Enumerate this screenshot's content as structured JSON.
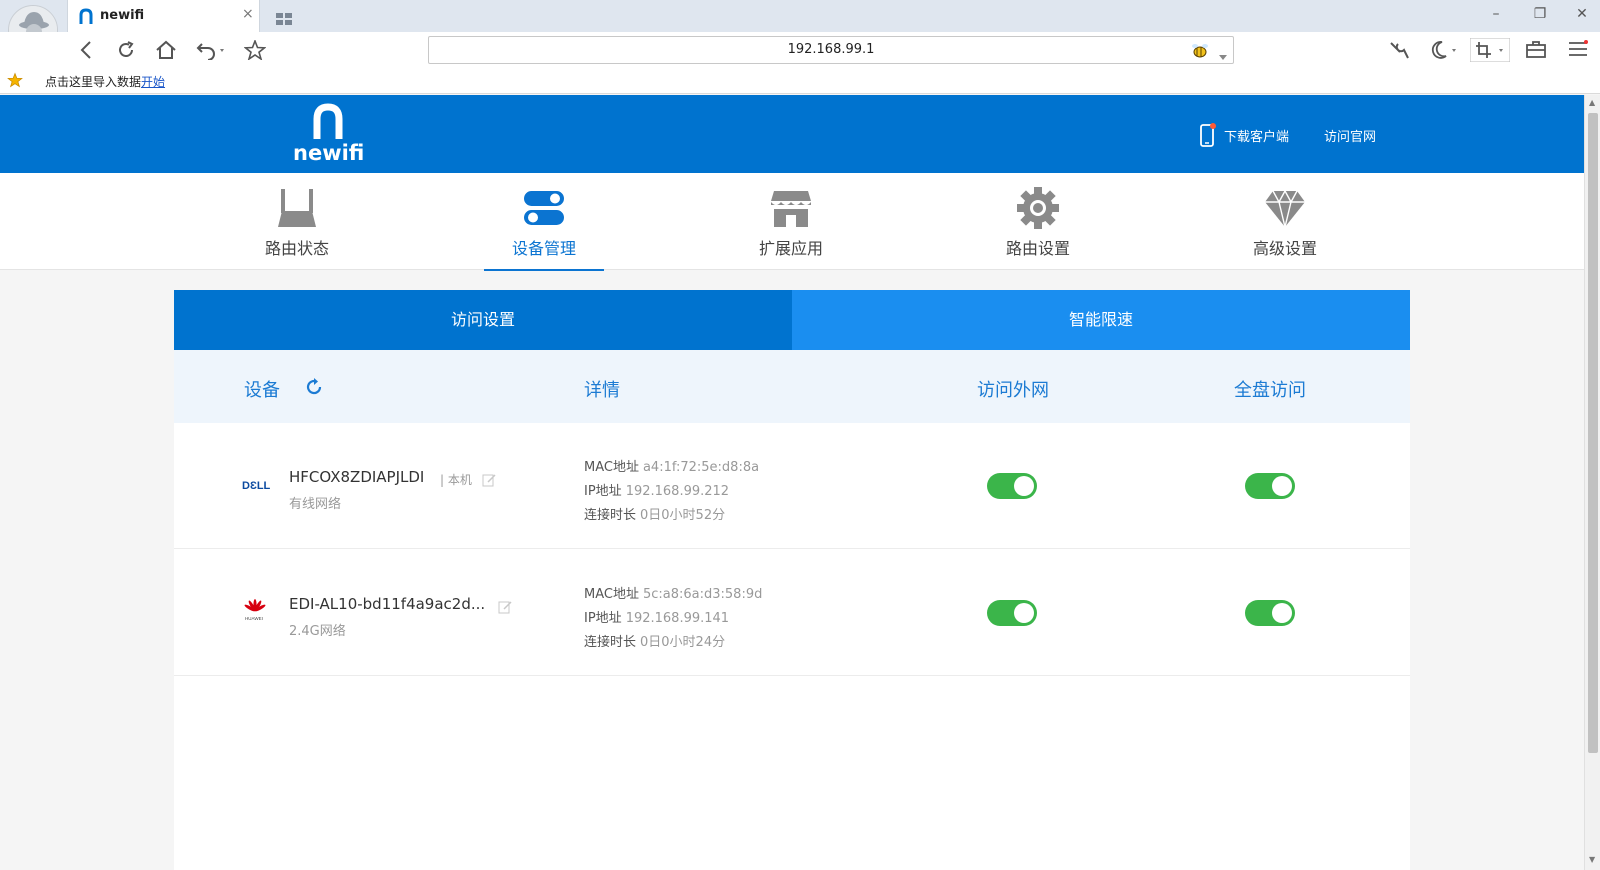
{
  "browser": {
    "tab_title": "newifi",
    "url": "192.168.99.1",
    "bookmark_prompt": "点击这里导入数据",
    "bookmark_link": "开始"
  },
  "header": {
    "logo_text": "newifi",
    "download_client": "下载客户端",
    "visit_site": "访问官网"
  },
  "nav": {
    "items": [
      {
        "label": "路由状态"
      },
      {
        "label": "设备管理"
      },
      {
        "label": "扩展应用"
      },
      {
        "label": "路由设置"
      },
      {
        "label": "高级设置"
      }
    ]
  },
  "subtabs": {
    "access": "访问设置",
    "speed": "智能限速"
  },
  "columns": {
    "device": "设备",
    "details": "详情",
    "internet": "访问外网",
    "disk": "全盘访问"
  },
  "labels": {
    "mac": "MAC地址",
    "ip": "IP地址",
    "duration": "连接时长"
  },
  "devices": [
    {
      "brand": "DELL",
      "name": "HFCOX8ZDIAPJLDI",
      "tag": "本机",
      "network": "有线网络",
      "mac": "a4:1f:72:5e:d8:8a",
      "ip": "192.168.99.212",
      "duration": "0日0小时52分",
      "internet": true,
      "disk": true
    },
    {
      "brand": "HUAWEI",
      "name": "EDI-AL10-bd11f4a9ac2d...",
      "tag": "",
      "network": "2.4G网络",
      "mac": "5c:a8:6a:d3:58:9d",
      "ip": "192.168.99.141",
      "duration": "0日0小时24分",
      "internet": true,
      "disk": true
    }
  ],
  "colors": {
    "header_blue": "#0073cf",
    "subtab_blue": "#1a8ef0",
    "toggle_green": "#3bb54a"
  }
}
